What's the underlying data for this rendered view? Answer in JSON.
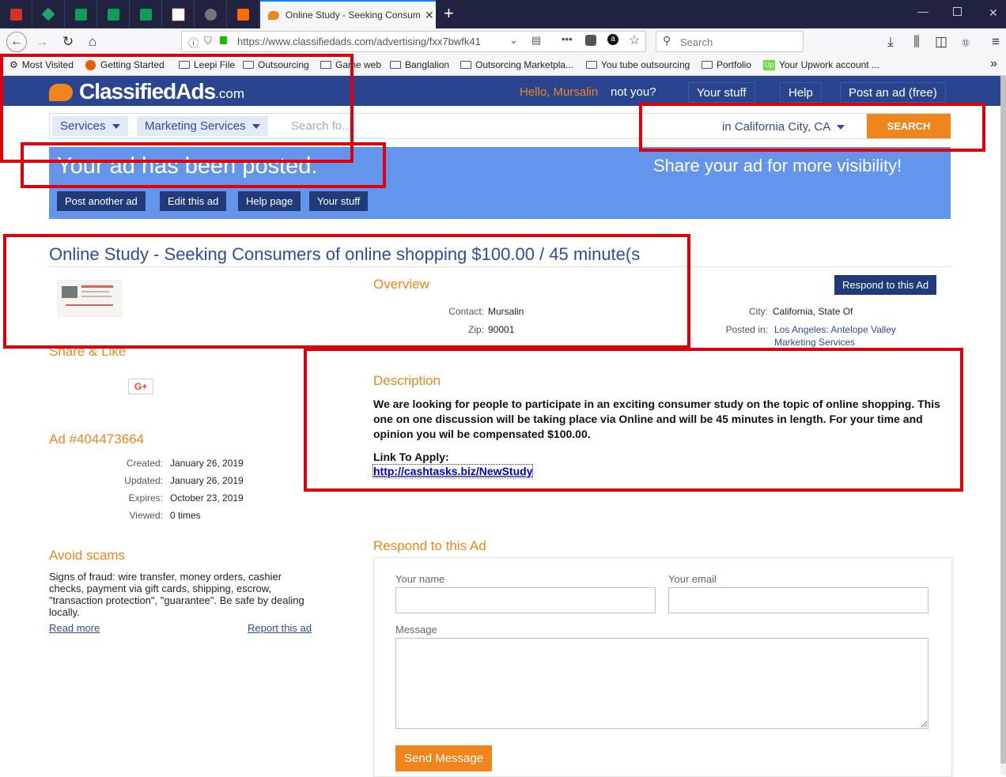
{
  "browser": {
    "active_tab_title": "Online Study - Seeking Consum",
    "url": "https://www.classifiedads.com/advertising/fxx7bwfk41",
    "search_placeholder": "Search",
    "bookmarks": [
      {
        "label": "Most Visited"
      },
      {
        "label": "Getting Started"
      },
      {
        "label": "Leepi File"
      },
      {
        "label": "Outsourcing"
      },
      {
        "label": "Game web"
      },
      {
        "label": "Banglalion"
      },
      {
        "label": "Outsorcing Marketpla..."
      },
      {
        "label": "You tube outsourcing"
      },
      {
        "label": "Portfolio"
      },
      {
        "label": "Your Upwork account ..."
      }
    ],
    "pinned_tab_colors": [
      "#d93025",
      "#1fa463",
      "#0f9d58",
      "#0f9d58",
      "#0f9d58",
      "#c0392b",
      "#777777",
      "#ff6a00"
    ]
  },
  "header": {
    "logo_main": "ClassifiedAds",
    "logo_suffix": ".com",
    "hello": "Hello, Mursalin",
    "not_you": "not you?",
    "your_stuff": "Your stuff",
    "help": "Help",
    "post_ad": "Post an ad (free)"
  },
  "search": {
    "category1": "Services",
    "category2": "Marketing Services",
    "placeholder": "Search fo...",
    "location": "in California City, CA",
    "button": "SEARCH"
  },
  "banner": {
    "posted": "Your ad has been posted.",
    "share": "Share your ad for more visibility!",
    "buttons": [
      "Post another ad",
      "Edit this ad",
      "Help page",
      "Your stuff"
    ]
  },
  "ad": {
    "title": "Online Study - Seeking Consumers of online shopping $100.00 / 45 minute(s",
    "respond_button": "Respond to this Ad",
    "overview_heading": "Overview",
    "contact_label": "Contact:",
    "contact": "Mursalin",
    "zip_label": "Zip:",
    "zip": "90001",
    "city_label": "City:",
    "city": "California, State Of",
    "posted_in_label": "Posted in:",
    "posted_in_1": "Los Angeles: Antelope Valley",
    "posted_in_2": "Marketing Services",
    "share_heading": "Share & Like",
    "gplus": "G+",
    "description_heading": "Description",
    "description": "We are looking for people to participate in an exciting consumer study on the topic of online shopping. This one on one discussion will be taking place via Online and will be 45 minutes in length. For your time and opinion you wil be compensated $100.00.",
    "link_label": "Link To Apply:",
    "link": "http://cashtasks.biz/NewStudy",
    "ad_number": "Ad #404473664",
    "meta": [
      {
        "label": "Created:",
        "value": "January 26, 2019"
      },
      {
        "label": "Updated:",
        "value": "January 26, 2019"
      },
      {
        "label": "Expires:",
        "value": "October 23, 2019"
      },
      {
        "label": "Viewed:",
        "value": "0 times"
      }
    ],
    "avoid_heading": "Avoid scams",
    "avoid_text": "Signs of fraud: wire transfer, money orders, cashier checks, payment via gift cards, shipping, escrow, \"transaction protection\", \"guarantee\". Be safe by dealing locally.",
    "read_more": "Read more",
    "report": "Report this ad"
  },
  "respond": {
    "heading": "Respond to this Ad",
    "name_label": "Your name",
    "email_label": "Your email",
    "message_label": "Message",
    "send": "Send Message"
  }
}
